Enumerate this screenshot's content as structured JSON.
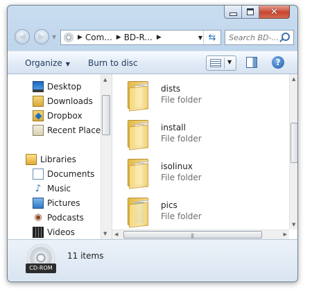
{
  "address": {
    "segments": [
      "Com...",
      "BD-R...",
      ""
    ],
    "refresh_icon": "refresh-icon"
  },
  "search": {
    "placeholder": "Search BD-..."
  },
  "commandbar": {
    "organize_label": "Organize",
    "burn_label": "Burn to disc"
  },
  "navpane": {
    "favorites": [
      {
        "label": "Desktop",
        "icon": "desktop-icon"
      },
      {
        "label": "Downloads",
        "icon": "downloads-folder-icon"
      },
      {
        "label": "Dropbox",
        "icon": "dropbox-folder-icon"
      },
      {
        "label": "Recent Places",
        "icon": "recent-places-icon"
      }
    ],
    "libraries_label": "Libraries",
    "libraries": [
      {
        "label": "Documents",
        "icon": "documents-icon"
      },
      {
        "label": "Music",
        "icon": "music-icon"
      },
      {
        "label": "Pictures",
        "icon": "pictures-icon"
      },
      {
        "label": "Podcasts",
        "icon": "podcasts-icon"
      },
      {
        "label": "Videos",
        "icon": "videos-icon"
      }
    ]
  },
  "files": [
    {
      "name": "dists",
      "type": "File folder"
    },
    {
      "name": "install",
      "type": "File folder"
    },
    {
      "name": "isolinux",
      "type": "File folder"
    },
    {
      "name": "pics",
      "type": "File folder"
    }
  ],
  "details": {
    "drive_label": "CD-ROM",
    "item_count": "11 items"
  },
  "colors": {
    "accent": "#1e395b",
    "close_button": "#c8452e",
    "window_frame": "#bcd2ea"
  }
}
